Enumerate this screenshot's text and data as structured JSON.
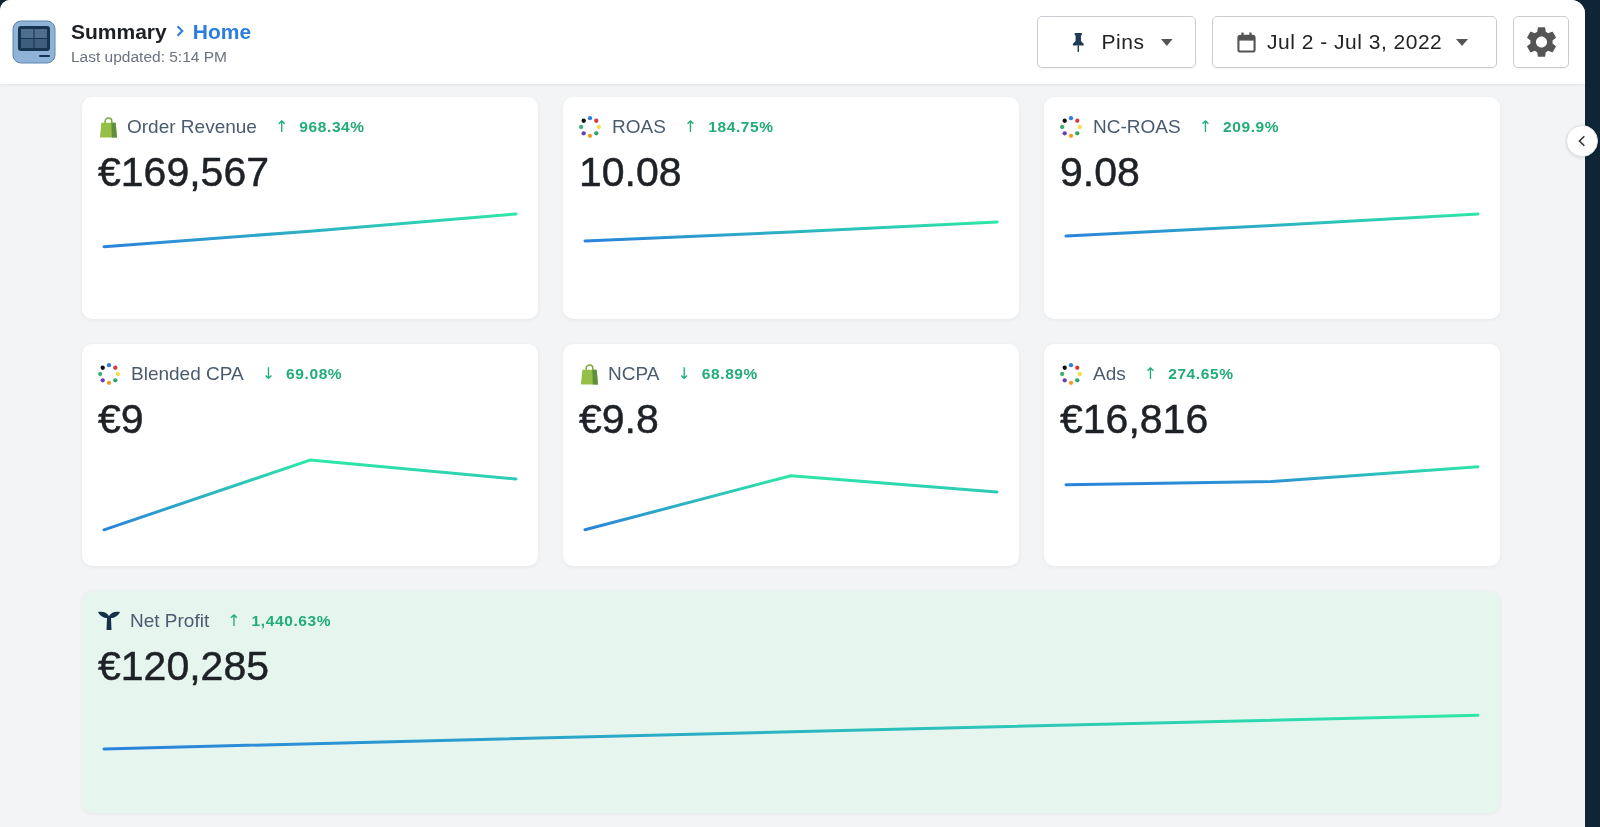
{
  "header": {
    "title": "Summary",
    "breadcrumb": "Home",
    "last_updated": "Last updated: 5:14 PM",
    "pins_button": "Pins",
    "date_range": "Jul 2 - Jul 3, 2022"
  },
  "rows": [
    {
      "cards": [
        {
          "kind": "bag",
          "label": "Order Revenue",
          "arrow": "↑",
          "change": "968.34%",
          "value": "€169,567",
          "highlighted": false
        },
        {
          "kind": "ring",
          "label": "ROAS",
          "arrow": "↑",
          "change": "184.75%",
          "value": "10.08",
          "highlighted": false
        },
        {
          "kind": "ring",
          "label": "NC-ROAS",
          "arrow": "↑",
          "change": "209.9%",
          "value": "9.08",
          "highlighted": false
        }
      ]
    },
    {
      "cards": [
        {
          "kind": "ring",
          "label": "Blended CPA",
          "arrow": "↓",
          "change": "69.08%",
          "value": "€9",
          "highlighted": false
        },
        {
          "kind": "bag",
          "label": "NCPA",
          "arrow": "↓",
          "change": "68.89%",
          "value": "€9.8",
          "highlighted": false
        },
        {
          "kind": "ring",
          "label": "Ads",
          "arrow": "↑",
          "change": "274.65%",
          "value": "€16,816",
          "highlighted": false
        }
      ]
    },
    {
      "cards": [
        {
          "kind": "tail",
          "label": "Net Profit",
          "arrow": "↑",
          "change": "1,440.63%",
          "value": "€120,285",
          "highlighted": true
        }
      ]
    }
  ]
}
